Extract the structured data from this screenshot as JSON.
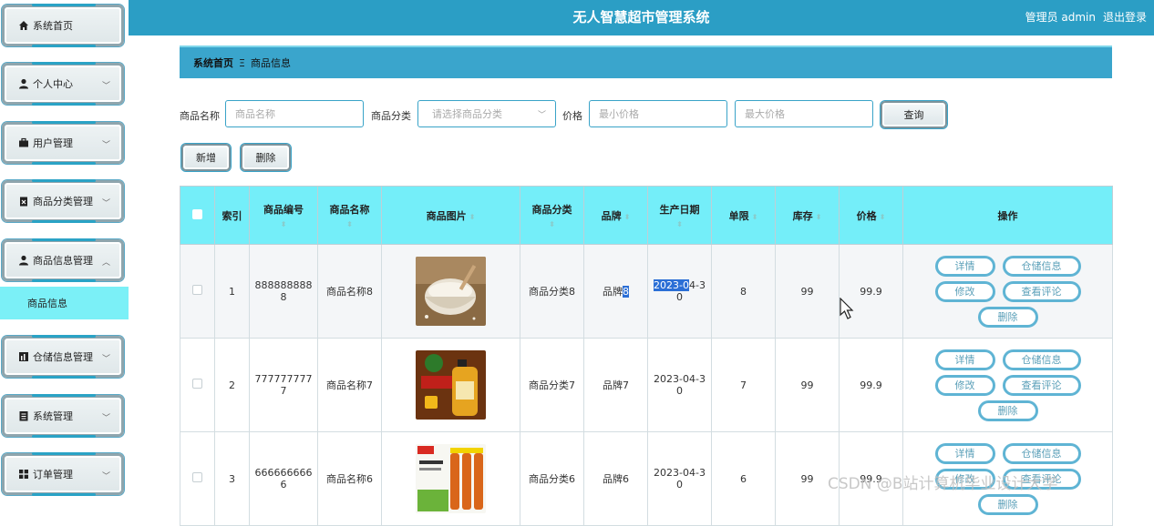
{
  "sidebar": {
    "items": [
      {
        "label": "系统首页",
        "icon": "home-icon"
      },
      {
        "label": "个人中心",
        "icon": "user-icon"
      },
      {
        "label": "用户管理",
        "icon": "briefcase-icon"
      },
      {
        "label": "商品分类管理",
        "icon": "clipboard-icon"
      },
      {
        "label": "商品信息管理",
        "icon": "user-icon"
      },
      {
        "label": "仓储信息管理",
        "icon": "chart-icon"
      },
      {
        "label": "系统管理",
        "icon": "list-icon"
      },
      {
        "label": "订单管理",
        "icon": "grid-icon"
      }
    ],
    "sub_item": "商品信息"
  },
  "header": {
    "title": "无人智慧超市管理系统",
    "admin": "管理员 admin",
    "logout": "退出登录"
  },
  "breadcrumb": {
    "home": "系统首页",
    "separator": "Ξ",
    "current": "商品信息"
  },
  "search": {
    "name_label": "商品名称",
    "name_placeholder": "商品名称",
    "category_label": "商品分类",
    "category_placeholder": "请选择商品分类",
    "price_label": "价格",
    "min_price_placeholder": "最小价格",
    "max_price_placeholder": "最大价格",
    "query_button": "查询"
  },
  "actions": {
    "add": "新增",
    "delete": "删除"
  },
  "table": {
    "headers": {
      "index": "索引",
      "code": "商品编号",
      "name": "商品名称",
      "image": "商品图片",
      "category": "商品分类",
      "brand": "品牌",
      "date": "生产日期",
      "limit": "单限",
      "stock": "库存",
      "price": "价格",
      "ops": "操作"
    },
    "rows": [
      {
        "index": "1",
        "code": "888888888",
        "code2": "8",
        "name": "商品名称8",
        "image": "flour-bowl",
        "category": "商品分类8",
        "brand": "品牌",
        "brand2": "8",
        "date": "2023-0",
        "date_rest": "4-3",
        "date2": "0",
        "limit": "8",
        "stock": "99",
        "price": "99.9"
      },
      {
        "index": "2",
        "code": "777777777",
        "code2": "7",
        "name": "商品名称7",
        "image": "cooking-oil",
        "category": "商品分类7",
        "brand": "品牌7",
        "date": "2023-04-3",
        "date2": "0",
        "limit": "7",
        "stock": "99",
        "price": "99.9"
      },
      {
        "index": "3",
        "code": "666666666",
        "code2": "6",
        "name": "商品名称6",
        "image": "soy-sauce-bottles",
        "category": "商品分类6",
        "brand": "品牌6",
        "date": "2023-04-3",
        "date2": "0",
        "limit": "6",
        "stock": "99",
        "price": "99.9"
      }
    ],
    "ops": {
      "detail": "详情",
      "storage": "仓储信息",
      "edit": "修改",
      "reviews": "查看评论",
      "delete": "删除"
    }
  },
  "watermark": "CSDN @B站计算机毕业设计大学",
  "colors": {
    "header": "#2b9ec5",
    "table_header": "#74eef9",
    "accent": "#39a3c8",
    "sub_item": "#7bf0f7"
  }
}
